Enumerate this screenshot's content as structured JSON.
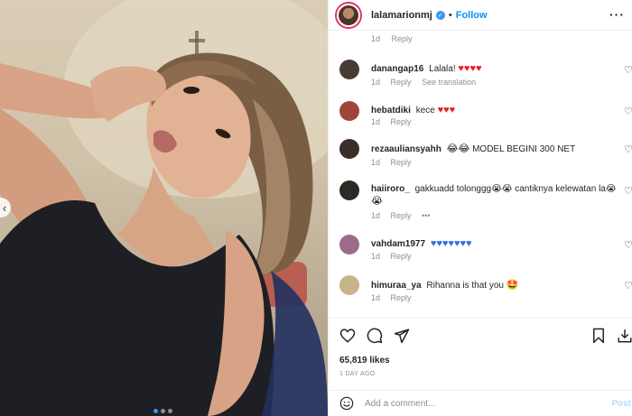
{
  "post": {
    "username": "lalamarionmj",
    "separator": "•",
    "follow_label": "Follow",
    "more_icon": "more-dots-icon"
  },
  "top_meta": {
    "time": "1d",
    "reply": "Reply"
  },
  "comments": [
    {
      "user": "danangap16",
      "text": "Lalala!",
      "emoji": "♥♥♥♥",
      "emoji_kind": "heart",
      "time": "1d",
      "reply": "Reply",
      "extra": "See translation",
      "avatar_color": "#4a3a34"
    },
    {
      "user": "hebatdiki",
      "text": "kece",
      "emoji": "♥♥♥",
      "emoji_kind": "heart",
      "time": "1d",
      "reply": "Reply",
      "extra": "",
      "avatar_color": "#a0453c"
    },
    {
      "user": "rezaauliansyahh",
      "text": "MODEL BEGINI 300 NET",
      "emoji_before": "😂😂",
      "emoji": "",
      "emoji_kind": "",
      "time": "1d",
      "reply": "Reply",
      "extra": "",
      "avatar_color": "#3a2d2a"
    },
    {
      "user": "haiiroro_",
      "text": "gakkuadd tolonggg😭😭 cantiknya kelewatan la😭",
      "line2": "😭",
      "emoji": "",
      "emoji_kind": "",
      "time": "1d",
      "reply": "Reply",
      "extra": "•••",
      "avatar_color": "#2d2a26"
    },
    {
      "user": "vahdam1977",
      "text": "",
      "emoji": "♥♥♥♥♥♥♥",
      "emoji_kind": "blue",
      "time": "1d",
      "reply": "Reply",
      "extra": "",
      "avatar_color": "#9c6a8a"
    },
    {
      "user": "himuraa_ya",
      "text": "Rihanna is that you",
      "emoji": "🤩",
      "emoji_kind": "face",
      "time": "1d",
      "reply": "Reply",
      "extra": "",
      "avatar_color": "#c8b48a"
    }
  ],
  "actions": {
    "like_icon": "heart-outline-icon",
    "comment_icon": "comment-icon",
    "share_icon": "share-icon",
    "save_icon": "bookmark-icon",
    "download_icon": "download-icon",
    "likes_text": "65,819 likes",
    "time_ago": "1 DAY AGO"
  },
  "add_comment": {
    "placeholder": "Add a comment...",
    "post_label": "Post",
    "emoji_icon": "smile-icon"
  },
  "colors": {
    "accent": "#0095f6",
    "verified": "#3897f0",
    "story_ring": "#e1306c",
    "muted_text": "#8e8e8e"
  }
}
